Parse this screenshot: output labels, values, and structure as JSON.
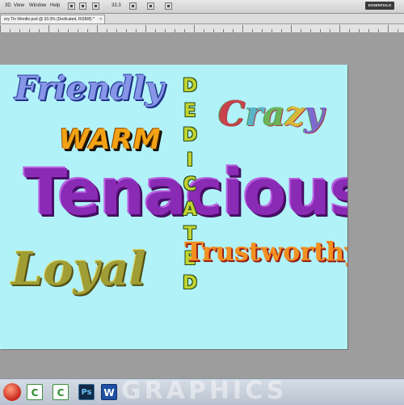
{
  "menubar": {
    "items": [
      "3D",
      "View",
      "Window",
      "Help"
    ],
    "zoom": "33.3",
    "workspace": "ESSENTIALS"
  },
  "document_tab": {
    "title": "ery Tin Wordle.psd @ 33.3% (Dedicated, RGB/8) *",
    "close": "×"
  },
  "canvas_words": {
    "friendly": "Friendly",
    "warm": "WARM",
    "crazy": [
      "C",
      "r",
      "a",
      "z",
      "y"
    ],
    "tenacious": "Tenacious",
    "dedicated": [
      "D",
      "E",
      "D",
      "I",
      "C",
      "A",
      "T",
      "E",
      "D"
    ],
    "trustworthy": "Trustworthy",
    "loyal": "Loyal"
  },
  "taskbar": {
    "apps": [
      {
        "name": "camtasia-recorder",
        "glyph": "C"
      },
      {
        "name": "camtasia-studio",
        "glyph": "C"
      },
      {
        "name": "photoshop",
        "glyph": "Ps"
      },
      {
        "name": "word",
        "glyph": "W"
      }
    ],
    "watermark": "GRAPHICS"
  },
  "colors": {
    "canvas_background": "#b0f2f8",
    "workspace_gray": "#9d9d9d",
    "tenacious": "#8a2bb5",
    "warm": "#f2a214",
    "loyal": "#a09d35",
    "dedicated": "#c1d430",
    "trustworthy": "#f29020",
    "friendly": "#8796e6"
  }
}
